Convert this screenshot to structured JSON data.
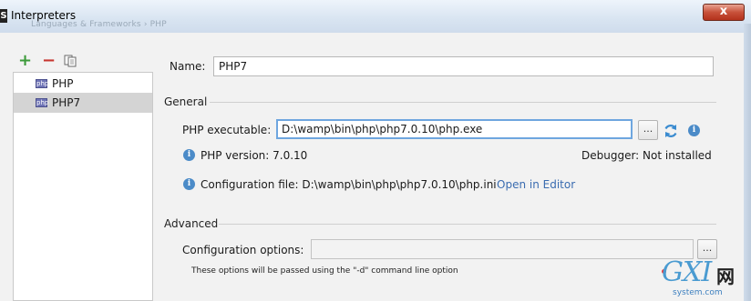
{
  "window": {
    "title": "Interpreters",
    "app_icon_letter": "S",
    "ghost_breadcrumb": "Languages & Frameworks  ›  PHP",
    "close_glyph": "x"
  },
  "toolbar": {
    "add_icon": "plus-icon",
    "remove_icon": "minus-icon",
    "copy_icon": "copy-icon"
  },
  "interpreters": {
    "items": [
      {
        "label": "PHP",
        "icon_text": "php",
        "selected": false
      },
      {
        "label": "PHP7",
        "icon_text": "php",
        "selected": true
      }
    ]
  },
  "form": {
    "name_label": "Name:",
    "name_value": "PHP7",
    "general_header": "General",
    "executable_label": "PHP executable:",
    "executable_value": "D:\\wamp\\bin\\php\\php7.0.10\\php.exe",
    "browse_label": "...",
    "version_text": "PHP version: 7.0.10",
    "debugger_text": "Debugger: Not installed",
    "config_file_text": "Configuration file: D:\\wamp\\bin\\php\\php7.0.10\\php.ini",
    "open_in_editor_link": "Open in Editor",
    "advanced_header": "Advanced",
    "config_options_label": "Configuration options:",
    "config_options_value": "",
    "config_browse_label": "...",
    "hint_text": "These options will be passed using the \"-d\" command line option"
  },
  "watermark": {
    "big": "GXI",
    "cn": "网",
    "small": "system.com"
  },
  "colors": {
    "accent_focus": "#6ea6df",
    "link": "#3a6cb0",
    "add_green": "#3c9a3a",
    "remove_red": "#c7352f",
    "info_blue": "#4b8bc8"
  }
}
